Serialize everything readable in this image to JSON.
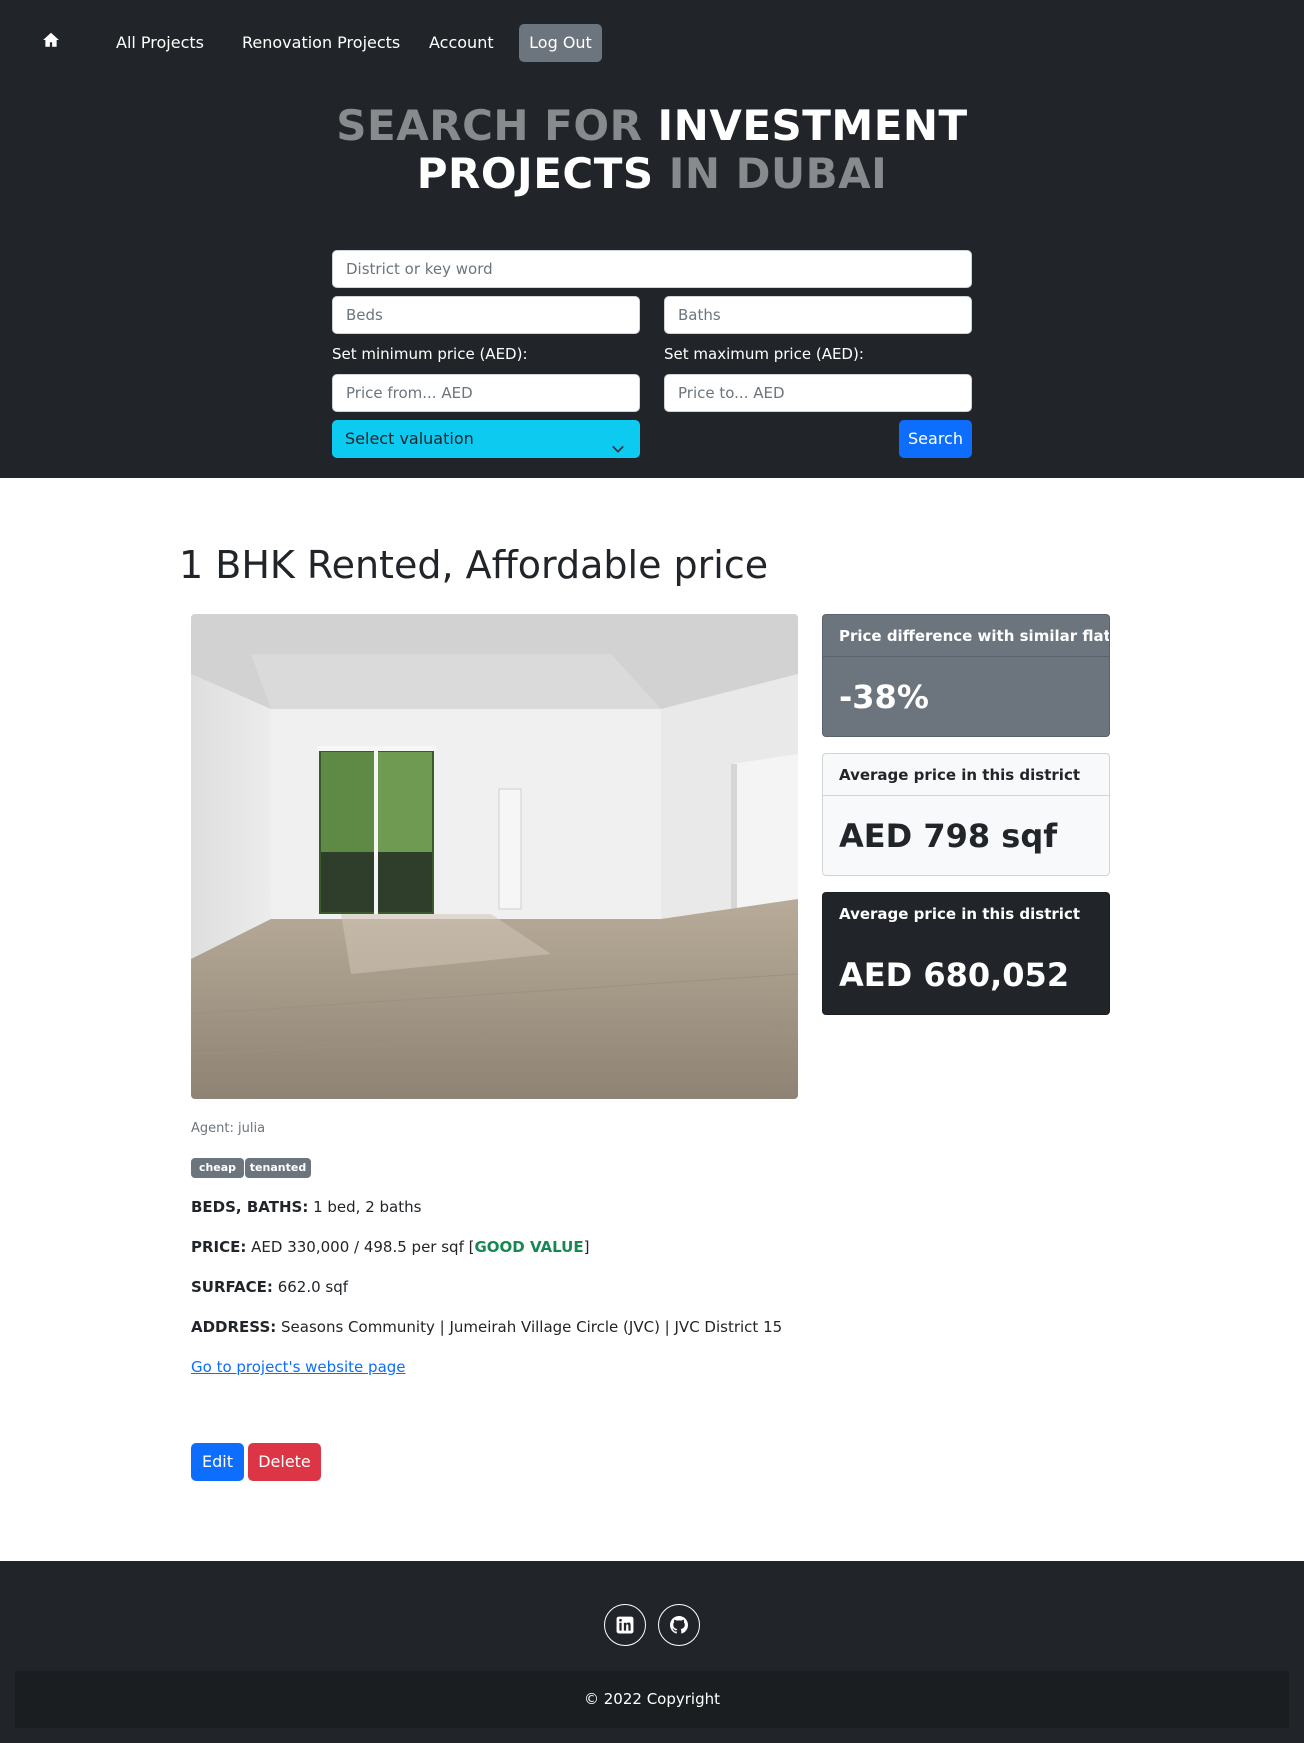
{
  "nav": {
    "home_icon": "house-icon",
    "links": [
      "All Projects",
      "Renovation Projects",
      "Account"
    ],
    "logout_label": "Log Out"
  },
  "hero": {
    "line1_dim": "SEARCH FOR ",
    "line1_bright": "INVESTMENT",
    "line2_bright": "PROJECTS",
    "line2_dim": " IN DUBAI"
  },
  "search": {
    "keyword_placeholder": "District or key word",
    "beds_placeholder": "Beds",
    "baths_placeholder": "Baths",
    "min_price_label": "Set minimum price (AED):",
    "max_price_label": "Set maximum price (AED):",
    "price_from_placeholder": "Price from... AED",
    "price_to_placeholder": "Price to... AED",
    "valuation_selected": "Select valuation",
    "search_label": "Search"
  },
  "project": {
    "title": "1 BHK Rented, Affordable price",
    "agent": "Agent: julia",
    "tags": [
      "cheap",
      "tenanted"
    ],
    "beds_baths_label": "BEDS, BATHS:",
    "beds_baths_value": " 1 bed, 2 baths",
    "price_label": "PRICE:",
    "price_value": " AED 330,000 / 498.5 per sqf [",
    "price_rating": "GOOD VALUE",
    "price_close": "]",
    "surface_label": "SURFACE:",
    "surface_value": " 662.0 sqf",
    "address_label": "ADDRESS:",
    "address_value": " Seasons Community | Jumeirah Village Circle (JVC) | JVC District 15",
    "website_link": "Go to project's website page",
    "edit_label": "Edit",
    "delete_label": "Delete"
  },
  "cards": [
    {
      "header": "Price difference with similar flats",
      "value": "-38%"
    },
    {
      "header": "Average price in this district",
      "value": "AED 798 sqf"
    },
    {
      "header": "Average price in this district",
      "value": "AED 680,052"
    }
  ],
  "footer": {
    "social_icons": [
      "linkedin-icon",
      "github-icon"
    ],
    "copyright": "© 2022 Copyright"
  },
  "colors": {
    "dark": "#212529",
    "secondary": "#6c757d",
    "primary": "#0d6efd",
    "info": "#0dcaf0",
    "danger": "#dc3545",
    "success": "#198754"
  }
}
